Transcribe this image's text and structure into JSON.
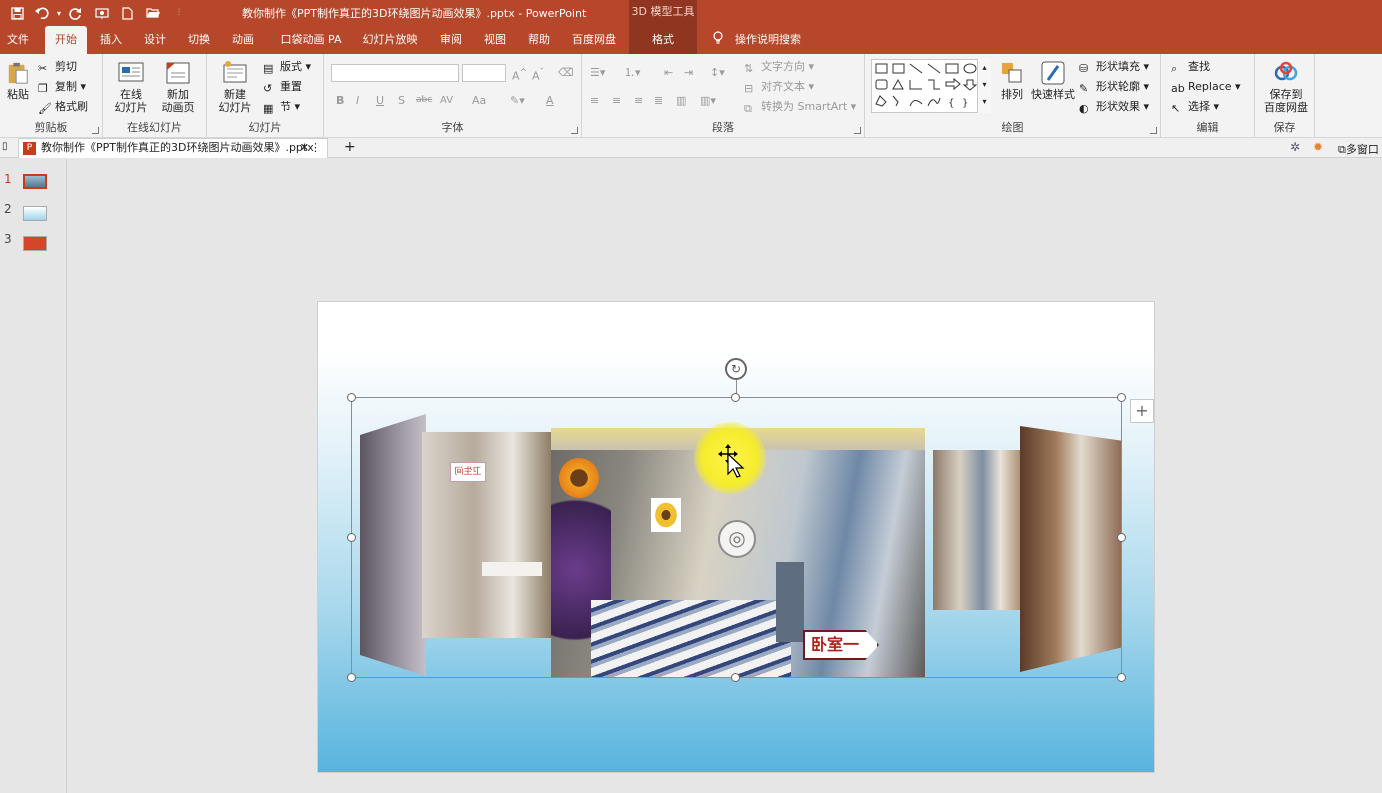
{
  "window": {
    "title": "教你制作《PPT制作真正的3D环绕图片动画效果》.pptx  -  PowerPoint",
    "context_header": "3D 模型工具"
  },
  "quick_access": {
    "save": "save-icon",
    "undo": "undo-icon",
    "redo": "redo-icon",
    "more": "▾"
  },
  "tabs": {
    "file": "文件",
    "home": "开始",
    "insert": "插入",
    "design": "设计",
    "transitions": "切换",
    "animations": "动画",
    "pocket": "口袋动画 PA",
    "slideshow": "幻灯片放映",
    "review": "审阅",
    "view": "视图",
    "help": "帮助",
    "baidu": "百度网盘",
    "format": "格式",
    "tellme": "操作说明搜索"
  },
  "ribbon": {
    "clipboard": {
      "label": "剪贴板",
      "paste": "粘贴",
      "cut": "剪切",
      "copy": "复制",
      "painter": "格式刷"
    },
    "online": {
      "label": "在线幻灯片",
      "online_slide_1": "在线",
      "online_slide_2": "幻灯片",
      "new_anim_1": "新加",
      "new_anim_2": "动画页"
    },
    "slides": {
      "label": "幻灯片",
      "new_1": "新建",
      "new_2": "幻灯片",
      "layout": "版式",
      "reset": "重置",
      "section": "节"
    },
    "font": {
      "label": "字体",
      "bold": "B",
      "italic": "I",
      "underline": "U",
      "shadow": "S",
      "strike": "abc",
      "spacing": "AV",
      "case": "Aa",
      "color": "A"
    },
    "paragraph": {
      "label": "段落",
      "text_dir": "文字方向",
      "align_text": "对齐文本",
      "smartart": "转换为 SmartArt"
    },
    "drawing": {
      "label": "绘图",
      "arrange": "排列",
      "quick_styles": "快速样式",
      "fill": "形状填充",
      "outline": "形状轮廓",
      "effects": "形状效果"
    },
    "editing": {
      "label": "编辑",
      "find": "查找",
      "replace": "Replace",
      "select": "选择"
    },
    "save": {
      "label": "保存",
      "save_to_1": "保存到",
      "save_to_2": "百度网盘"
    }
  },
  "doc_tab": {
    "name": "教你制作《PPT制作真正的3D环绕图片动画效果》.pptx",
    "close": "✕",
    "menu": "⋮",
    "add": "+",
    "multi_window": "多窗口"
  },
  "thumbnails": [
    {
      "num": "1"
    },
    {
      "num": "2"
    },
    {
      "num": "3"
    }
  ],
  "slide": {
    "label_tag": "卧室一",
    "sign_small": "卫生间"
  },
  "colors": {
    "accent": "#b7472a",
    "accent_dark": "#8f3520",
    "selection": "#c43e1c"
  }
}
